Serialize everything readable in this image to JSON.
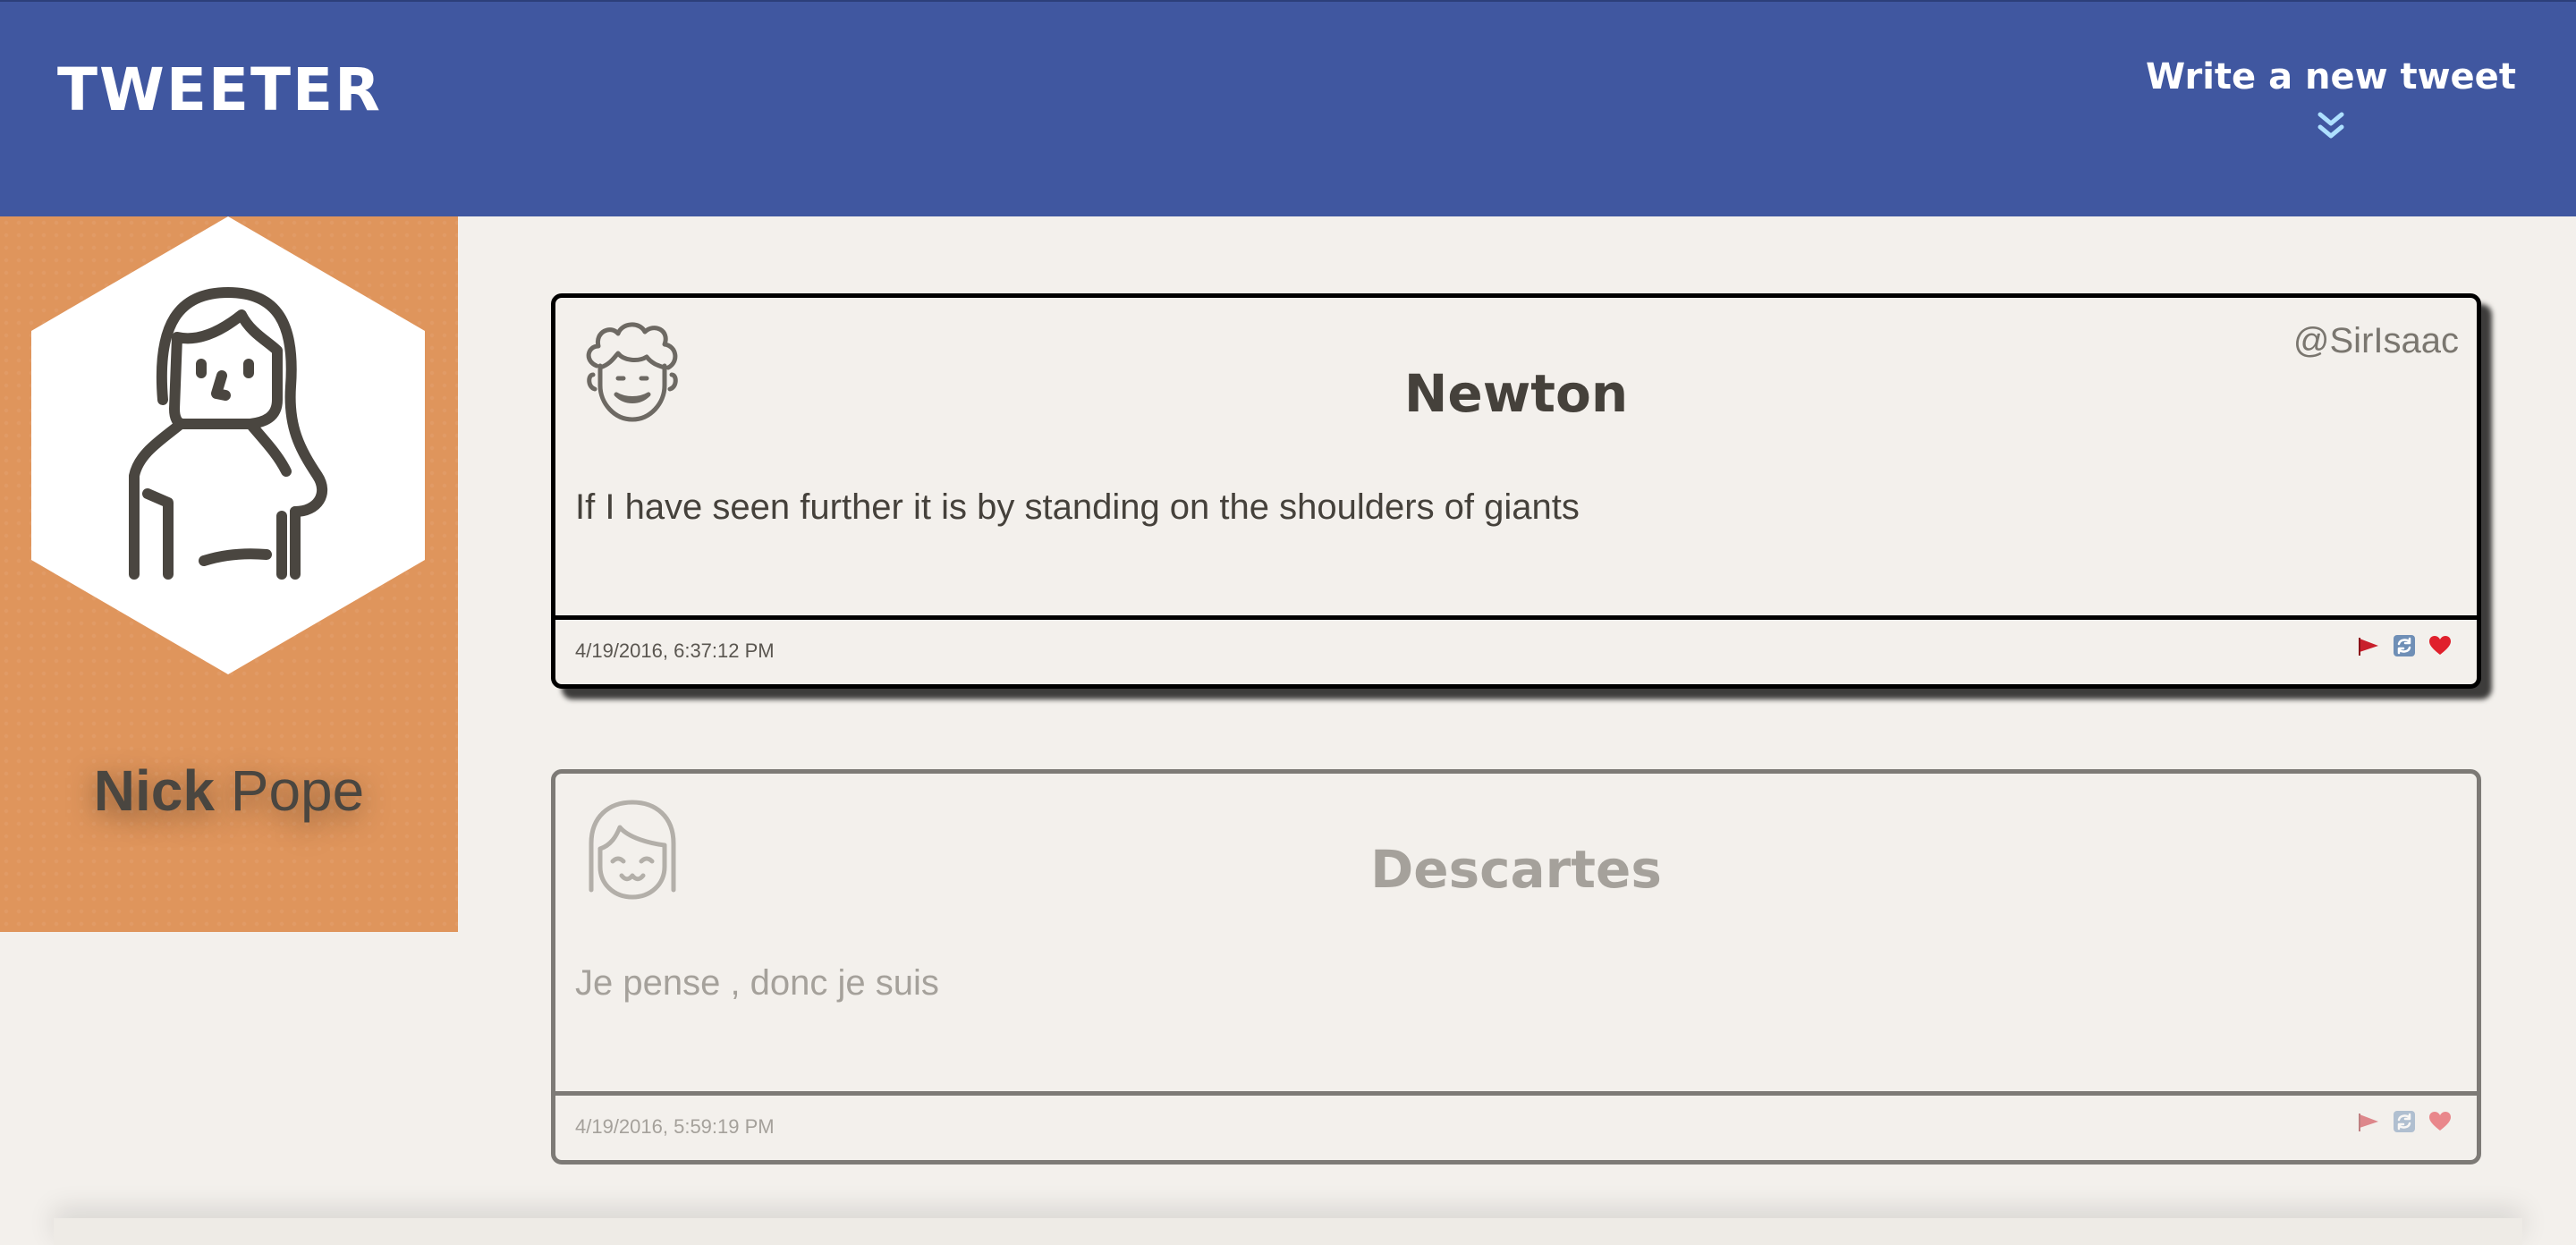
{
  "nav": {
    "brand": "TWEETER",
    "compose_label": "Write a new tweet",
    "compose_icon": "double-chevron-down-icon",
    "background": "#4057a0"
  },
  "profile": {
    "first_name": "Nick",
    "last_name": "Pope",
    "avatar_icon": "woman-avatar-icon",
    "background": "#df955c"
  },
  "tweets": [
    {
      "name": "Newton",
      "handle": "@SirIsaac",
      "avatar_icon": "curly-hair-man-avatar-icon",
      "text": "If I have seen further it is by standing on the shoulders of giants",
      "timestamp": "4/19/2016, 6:37:12 PM",
      "actions": [
        "flag-icon",
        "retweet-icon",
        "heart-icon"
      ]
    },
    {
      "name": "Descartes",
      "handle": "",
      "avatar_icon": "bob-hair-avatar-icon",
      "text": "Je pense , donc je suis",
      "timestamp": "4/19/2016, 5:59:19 PM",
      "actions": [
        "flag-icon",
        "retweet-icon",
        "heart-icon"
      ]
    }
  ]
}
